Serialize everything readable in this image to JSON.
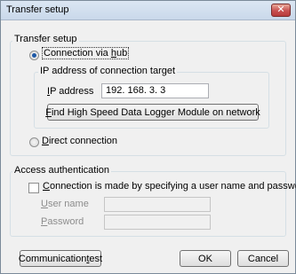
{
  "window": {
    "title": "Transfer setup",
    "close_glyph": "✕"
  },
  "transfer_setup": {
    "group_label": "Transfer setup",
    "via_hub": {
      "pre": "Connection via ",
      "mnemonic": "h",
      "post": "ub",
      "checked": true
    },
    "target_group_label": "IP address of connection target",
    "ip_label": {
      "mnemonic": "I",
      "post": "P address"
    },
    "ip_value": "192. 168. 3. 3",
    "find_button": {
      "mnemonic": "F",
      "post": "ind High Speed Data Logger Module on network"
    },
    "direct": {
      "mnemonic": "D",
      "post": "irect connection",
      "checked": false
    }
  },
  "access": {
    "group_label": "Access authentication",
    "checkbox": {
      "mnemonic": "C",
      "post": "onnection is made by specifying a user name and password",
      "checked": false
    },
    "user_label": {
      "mnemonic": "U",
      "post": "ser name"
    },
    "user_value": "",
    "password_label": {
      "mnemonic": "P",
      "post": "assword"
    },
    "password_value": ""
  },
  "buttons": {
    "comm_test": {
      "pre": "Communication ",
      "mnemonic": "t",
      "post": "est"
    },
    "ok": "OK",
    "cancel": "Cancel"
  }
}
